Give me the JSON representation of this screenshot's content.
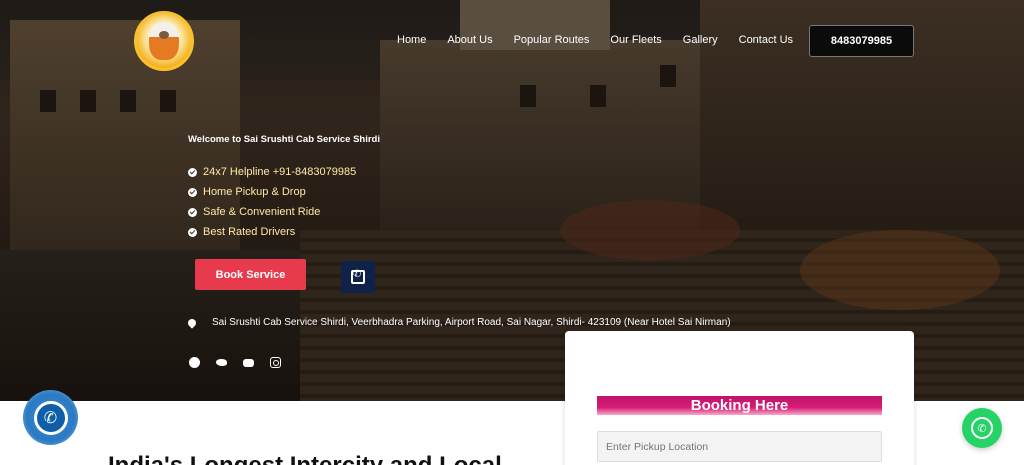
{
  "header": {
    "logo_alt": "Sai Baba logo",
    "nav": [
      "Home",
      "About Us",
      "Popular Routes",
      "Our Fleets",
      "Gallery",
      "Contact Us"
    ],
    "phone_button": "8483079985"
  },
  "hero": {
    "welcome": "Welcome to Sai Srushti Cab Service Shirdi",
    "features": [
      "24x7 Helpline +91-8483079985",
      "Home Pickup & Drop",
      "Safe & Convenient Ride",
      "Best Rated Drivers"
    ],
    "book_button": "Book Service",
    "call_icon": "phone-icon",
    "address": "Sai Srushti Cab Service Shirdi, Veerbhadra Parking, Airport Road, Sai Nagar, Shirdi- 423109 (Near Hotel Sai Nirman)",
    "social_icons": [
      "facebook-icon",
      "twitter-icon",
      "youtube-icon",
      "instagram-icon"
    ]
  },
  "booking": {
    "title": "Booking Here",
    "pickup_placeholder": "Enter Pickup Location"
  },
  "section": {
    "heading_partial": "India's Longest Intercity and Local"
  },
  "colors": {
    "book_button": "#e83a4d",
    "call_button": "#10214a",
    "booking_title": "#c0136a",
    "whatsapp": "#25d366",
    "feature_text": "#ffe9a8"
  }
}
